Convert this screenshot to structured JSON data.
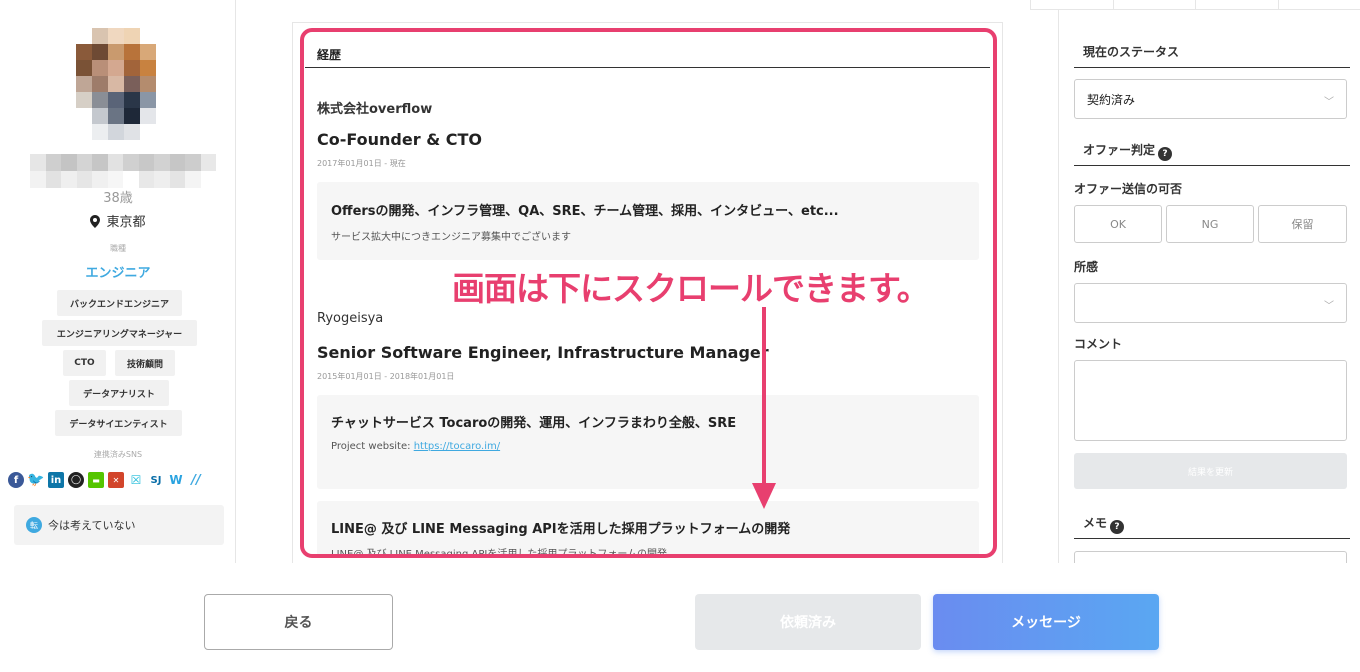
{
  "profile": {
    "age": "38歳",
    "location": "東京都",
    "job_label": "職種",
    "job": "エンジニア",
    "tags": [
      "バックエンドエンジニア",
      "エンジニアリングマネージャー",
      "CTO",
      "技術顧問",
      "データアナリスト",
      "データサイエンティスト"
    ],
    "sns_label": "連携済みSNS",
    "job_status": "今は考えていない",
    "job_status_icon": "転"
  },
  "career": {
    "section_title": "経歴",
    "entries": [
      {
        "company": "株式会社overflow",
        "role": "Co-Founder & CTO",
        "period": "2017年01月01日 - 現在",
        "projects": [
          {
            "title": "Offersの開発、インフラ管理、QA、SRE、チーム管理、採用、インタビュー、etc...",
            "desc": "サービス拡大中につきエンジニア募集中でございます"
          }
        ]
      },
      {
        "company": "Ryogeisya",
        "role": "Senior Software Engineer, Infrastructure Manager",
        "period": "2015年01月01日 - 2018年01月01日",
        "projects": [
          {
            "title": "チャットサービス Tocaroの開発、運用、インフラまわり全般、SRE",
            "desc_prefix": "Project website: ",
            "link": "https://tocaro.im/"
          },
          {
            "title": "LINE@ 及び LINE Messaging APIを活用した採用プラットフォームの開発",
            "desc": "LINE@ 及び LINE Messaging APIを活用した採用プラットフォームの開発"
          }
        ]
      }
    ]
  },
  "annotation": {
    "text": "画面は下にスクロールできます。",
    "color": "#e83f6f"
  },
  "sidebar": {
    "current_status_heading": "現在のステータス",
    "status_value": "契約済み",
    "offer_heading": "オファー判定",
    "offer_send_label": "オファー送信の可否",
    "offer_options": [
      "OK",
      "NG",
      "保留"
    ],
    "impression_label": "所感",
    "impression_value": "",
    "comment_label": "コメント",
    "comment_value": "",
    "update_button": "結果を更新",
    "memo_heading": "メモ"
  },
  "actions": {
    "back": "戻る",
    "requested": "依頼済み",
    "message": "メッセージ"
  },
  "colors": {
    "accent_blue": "#3fa9e0",
    "highlight_pink": "#e83f6f"
  }
}
